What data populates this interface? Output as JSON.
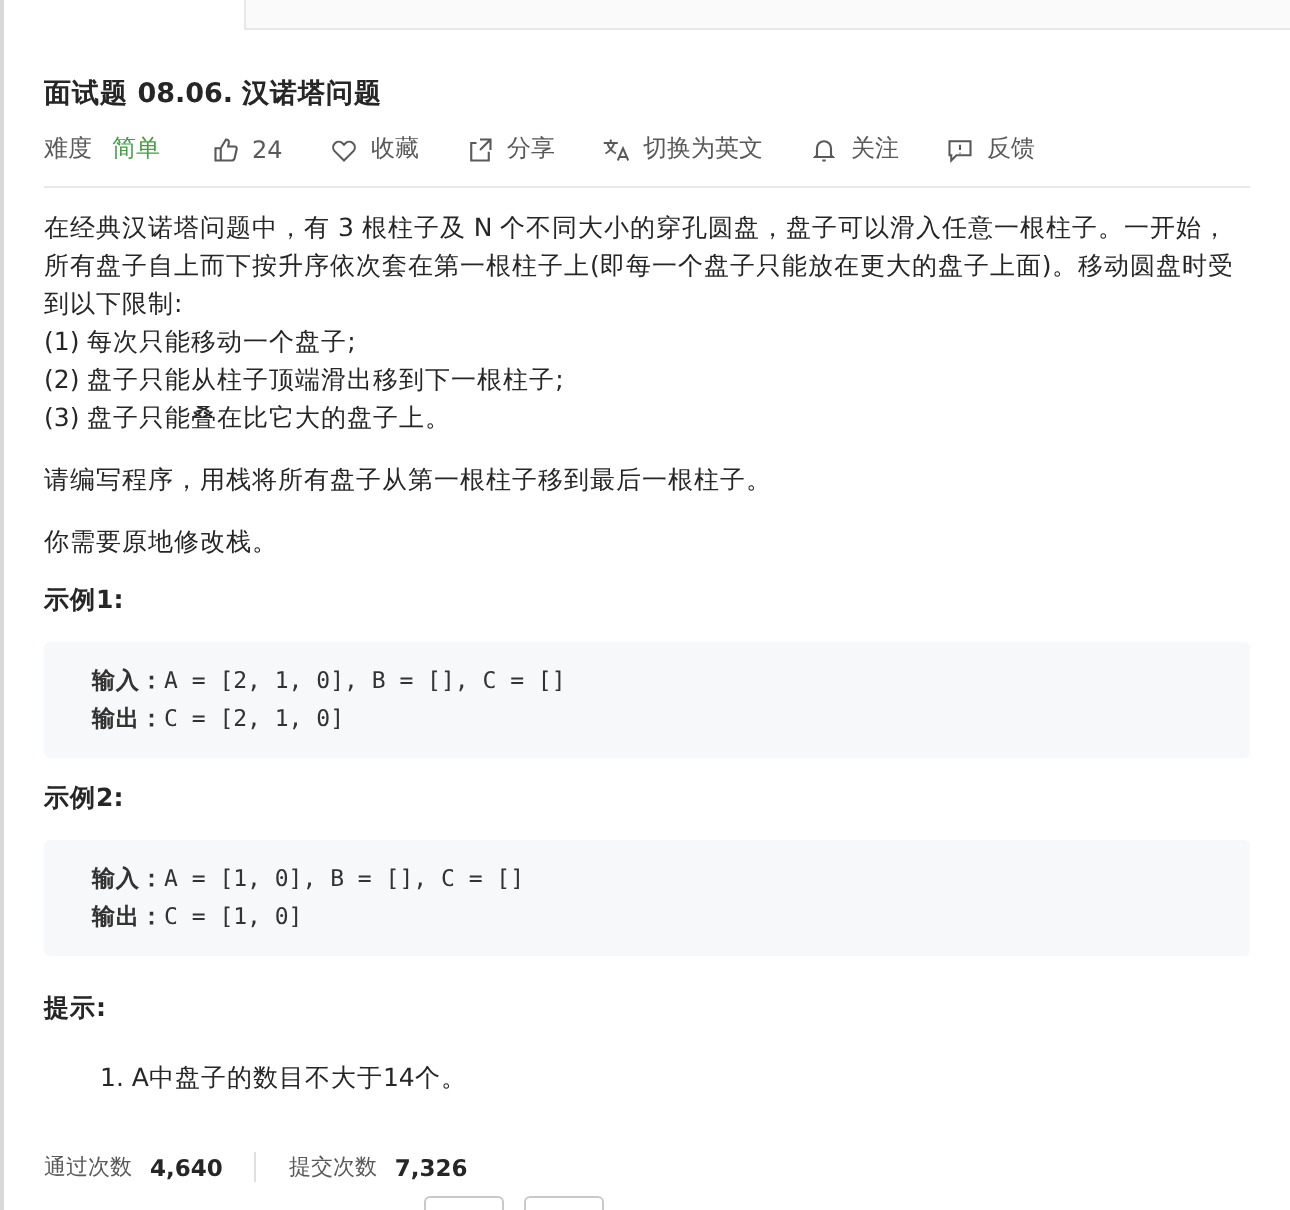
{
  "title": "面试题 08.06. 汉诺塔问题",
  "meta": {
    "difficulty_label": "难度",
    "difficulty": "简单",
    "likes": "24",
    "actions": [
      {
        "kind": "favorite",
        "label": "收藏"
      },
      {
        "kind": "share",
        "label": "分享"
      },
      {
        "kind": "translate",
        "label": "切换为英文"
      },
      {
        "kind": "follow",
        "label": "关注"
      },
      {
        "kind": "feedback",
        "label": "反馈"
      }
    ]
  },
  "description": {
    "intro": "在经典汉诺塔问题中，有 3 根柱子及 N 个不同大小的穿孔圆盘，盘子可以滑入任意一根柱子。一开始，所有盘子自上而下按升序依次套在第一根柱子上(即每一个盘子只能放在更大的盘子上面)。移动圆盘时受到以下限制:",
    "rules": [
      "(1) 每次只能移动一个盘子;",
      "(2) 盘子只能从柱子顶端滑出移到下一根柱子;",
      "(3) 盘子只能叠在比它大的盘子上。"
    ],
    "paragraphs": [
      "请编写程序，用栈将所有盘子从第一根柱子移到最后一根柱子。",
      "你需要原地修改栈。"
    ]
  },
  "examples": [
    {
      "title": "示例1:",
      "lines": [
        "**输入：**A = [2, 1, 0], B = [], C = []",
        "**输出：**C = [2, 1, 0]"
      ]
    },
    {
      "title": "示例2:",
      "lines": [
        "**输入：**A = [1, 0], B = [], C = []",
        "**输出：**C = [1, 0]"
      ]
    }
  ],
  "hints": {
    "title": "提示:",
    "items": [
      "1. A中盘子的数目不大于14个。"
    ]
  },
  "stats": [
    {
      "label": "通过次数",
      "value": "4,640"
    },
    {
      "label": "提交次数",
      "value": "7,326"
    }
  ]
}
